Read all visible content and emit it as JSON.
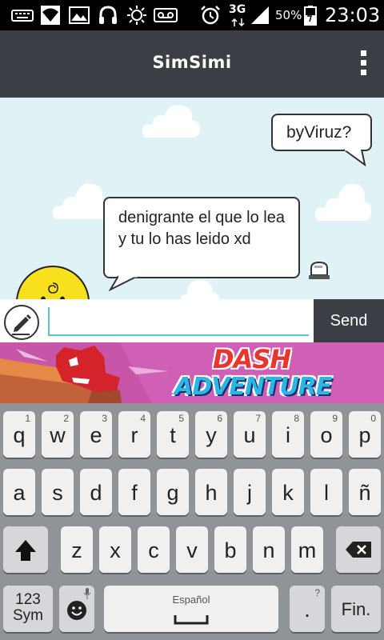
{
  "status": {
    "network": "3G",
    "battery": "50%",
    "time": "23:03"
  },
  "app": {
    "title": "SimSimi"
  },
  "chat": {
    "messages": [
      {
        "text": "byViruz?",
        "side": "right"
      },
      {
        "text": "denigrante el que lo lea y tu lo has leido xd",
        "side": "left"
      }
    ]
  },
  "input": {
    "value": "",
    "send_label": "Send"
  },
  "ad": {
    "word1": "DASH",
    "word2": "ADVENTURE"
  },
  "keyboard": {
    "row1": [
      {
        "key": "q",
        "hint": "1"
      },
      {
        "key": "w",
        "hint": "2"
      },
      {
        "key": "e",
        "hint": "3"
      },
      {
        "key": "r",
        "hint": "4"
      },
      {
        "key": "t",
        "hint": "5"
      },
      {
        "key": "y",
        "hint": "6"
      },
      {
        "key": "u",
        "hint": "7"
      },
      {
        "key": "i",
        "hint": "8"
      },
      {
        "key": "o",
        "hint": "9"
      },
      {
        "key": "p",
        "hint": "0"
      }
    ],
    "row2": [
      "a",
      "s",
      "d",
      "f",
      "g",
      "h",
      "j",
      "k",
      "l",
      "ñ"
    ],
    "row3": [
      "z",
      "x",
      "c",
      "v",
      "b",
      "n",
      "m"
    ],
    "sym_top": "123",
    "sym_bottom": "Sym",
    "space_label": "Español",
    "period": ".",
    "period_hint": "?",
    "fin_label": "Fin.",
    "accent": "#3b3f45",
    "chat_bg": "#dff2f6"
  }
}
